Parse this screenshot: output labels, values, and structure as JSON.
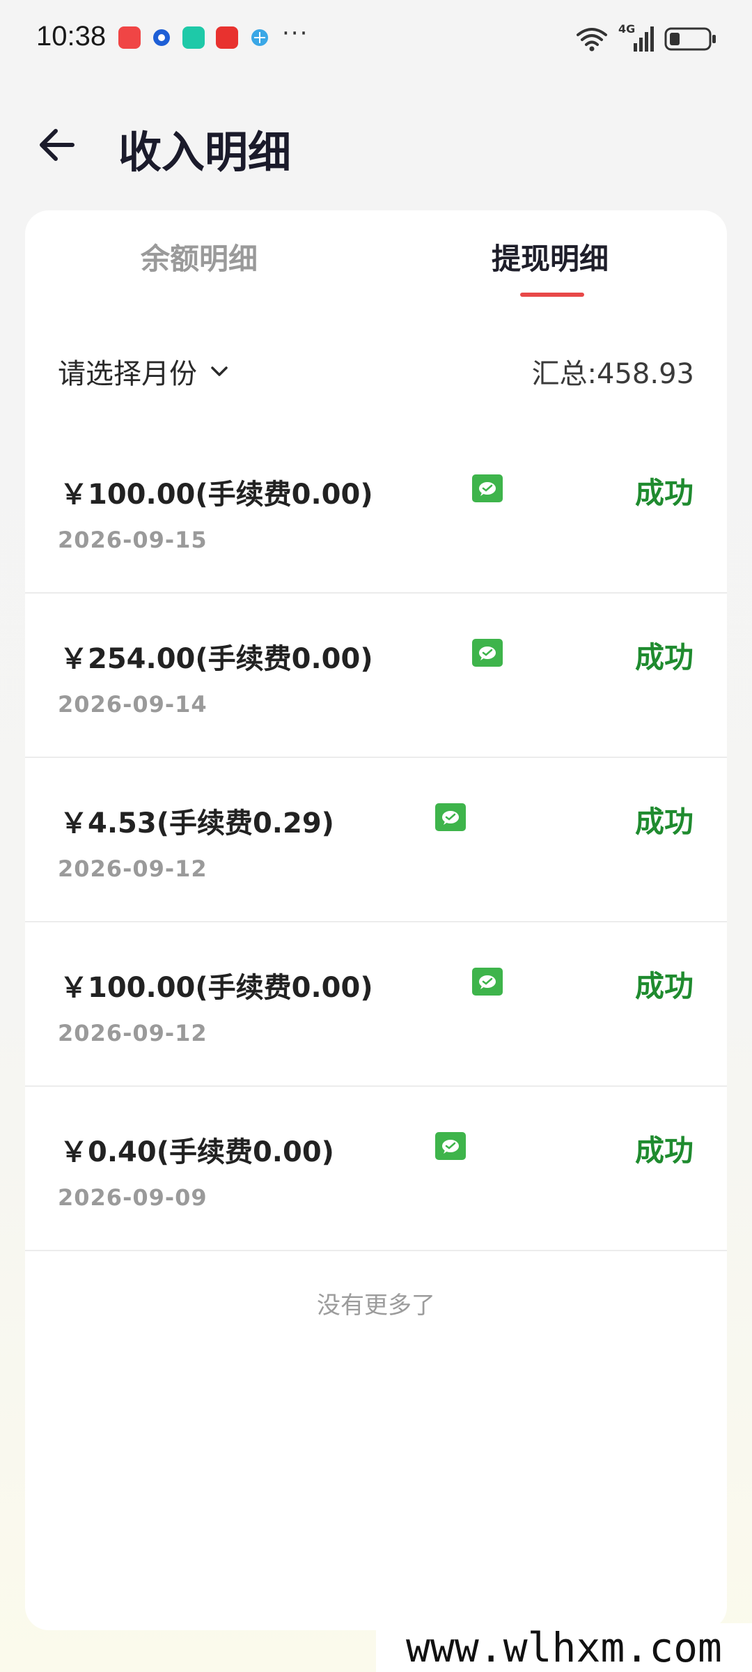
{
  "status_bar": {
    "time": "10:38",
    "overflow": "···",
    "network": "4G",
    "icons": [
      "app-badge-icon",
      "wifi-icon",
      "signal-icon",
      "battery-icon"
    ]
  },
  "header": {
    "title": "收入明细",
    "back_icon": "back-arrow-icon"
  },
  "tabs": [
    {
      "label": "余额明细",
      "active": false
    },
    {
      "label": "提现明细",
      "active": true
    }
  ],
  "filter": {
    "month_label": "请选择月份",
    "total": "汇总:458.93"
  },
  "records": [
    {
      "amount": "￥100.00(手续费0.00)",
      "date": "2026-09-15",
      "status": "成功",
      "icon": "wechat-icon"
    },
    {
      "amount": "￥254.00(手续费0.00)",
      "date": "2026-09-14",
      "status": "成功",
      "icon": "wechat-icon"
    },
    {
      "amount": "￥4.53(手续费0.29)",
      "date": "2026-09-12",
      "status": "成功",
      "icon": "wechat-icon"
    },
    {
      "amount": "￥100.00(手续费0.00)",
      "date": "2026-09-12",
      "status": "成功",
      "icon": "wechat-icon"
    },
    {
      "amount": "￥0.40(手续费0.00)",
      "date": "2026-09-09",
      "status": "成功",
      "icon": "wechat-icon"
    }
  ],
  "footer": {
    "no_more": "没有更多了"
  },
  "watermark": "www.wlhxm.com",
  "colors": {
    "accent_red": "#e84848",
    "success_green": "#1f8b2f",
    "wechat_green": "#3eb44b"
  }
}
